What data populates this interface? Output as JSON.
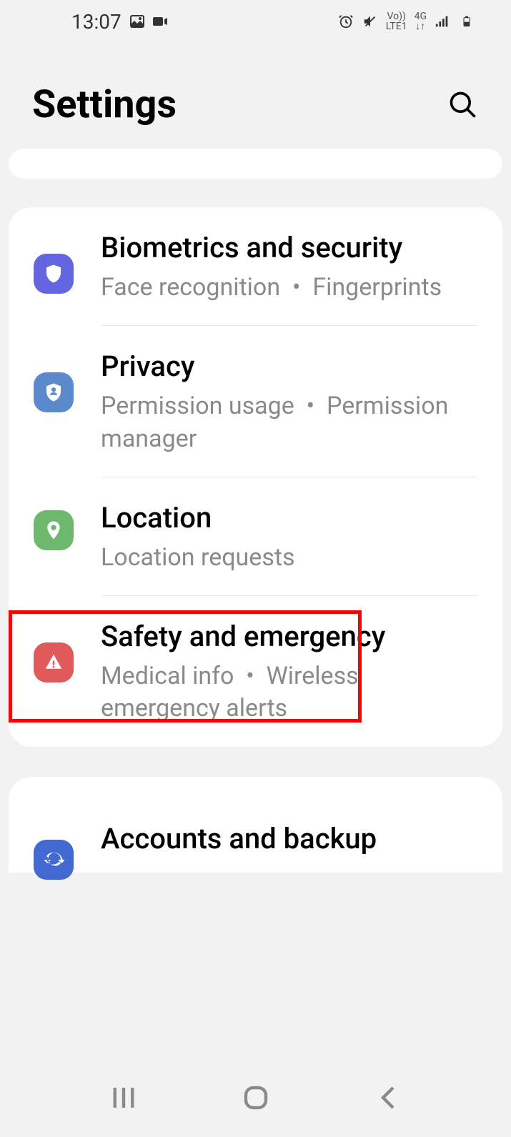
{
  "statusBar": {
    "time": "13:07",
    "network": {
      "volte": "Vo))",
      "lte": "LTE1",
      "gen": "4G"
    }
  },
  "header": {
    "title": "Settings"
  },
  "items": {
    "biometrics": {
      "title": "Biometrics and security",
      "sub1": "Face recognition",
      "sub2": "Fingerprints"
    },
    "privacy": {
      "title": "Privacy",
      "sub1": "Permission usage",
      "sub2": "Permission manager"
    },
    "location": {
      "title": "Location",
      "sub1": "Location requests"
    },
    "safety": {
      "title": "Safety and emergency",
      "sub1": "Medical info",
      "sub2": "Wireless emergency alerts"
    },
    "accounts": {
      "title": "Accounts and backup"
    }
  },
  "highlight": {
    "target": "location"
  }
}
